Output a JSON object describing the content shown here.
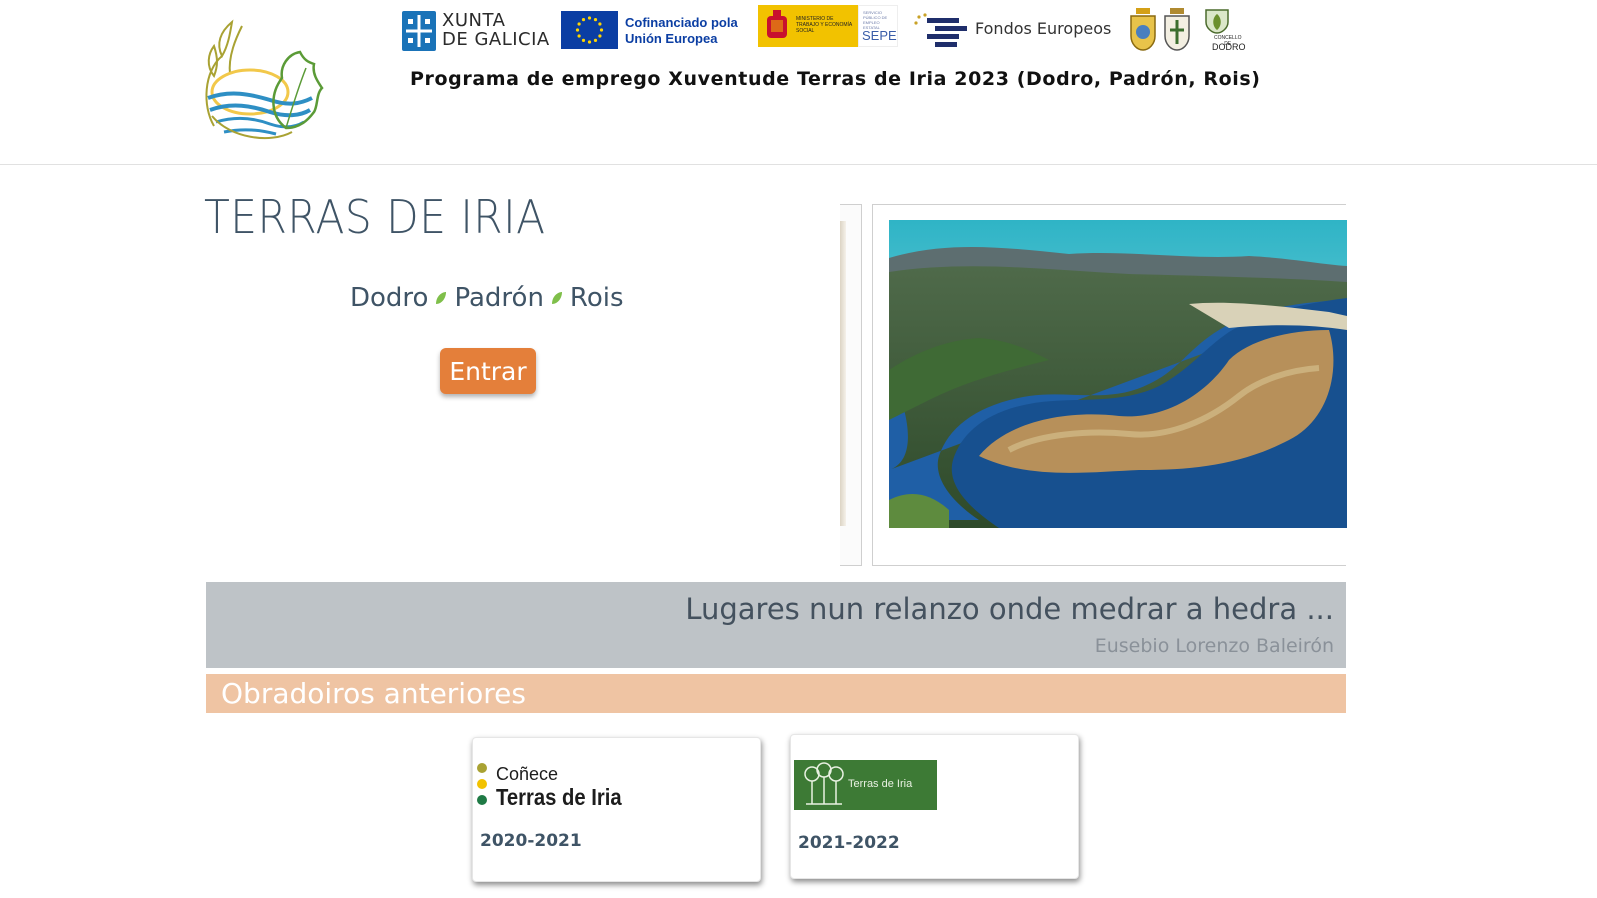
{
  "header": {
    "logo_icon": "terras-de-iria-logo",
    "sponsors": {
      "xunta": {
        "line1": "XUNTA",
        "line2": "DE GALICIA"
      },
      "eu": {
        "line1": "Cofinanciado pola",
        "line2": "Unión Europea"
      },
      "ministerio": {
        "small": "MINISTERIO DE TRABAJO Y ECONOMÍA SOCIAL",
        "sepe_small": "SERVICIO PÚBLICO DE EMPLEO ESTATAL",
        "sepe": "SEPE"
      },
      "fondos": "Fondos Europeos",
      "concello": "CONCELLO DE",
      "dodro": "DODRO"
    },
    "program_title": "Programa de emprego Xuventude Terras de Iria 2023 (Dodro, Padrón, Rois)"
  },
  "hero": {
    "title": "TERRAS DE IRIA",
    "towns": [
      "Dodro",
      "Padrón",
      "Rois"
    ],
    "enter_label": "Entrar"
  },
  "quote": {
    "text": "Lugares nun relanzo onde medrar a hedra ...",
    "author": "Eusebio Lorenzo Baleirón"
  },
  "previous": {
    "title": "Obradoiros anteriores",
    "cards": [
      {
        "logo_small": "Coñece",
        "logo_big": "Terras de Iria",
        "year": "2020-2021"
      },
      {
        "logo_text": "Terras de Iria",
        "year": "2021-2022"
      }
    ]
  },
  "colors": {
    "accent": "#e47f3a",
    "section_bar": "#efc4a3",
    "quote_band": "#bec3c7",
    "text": "#3f5466"
  }
}
